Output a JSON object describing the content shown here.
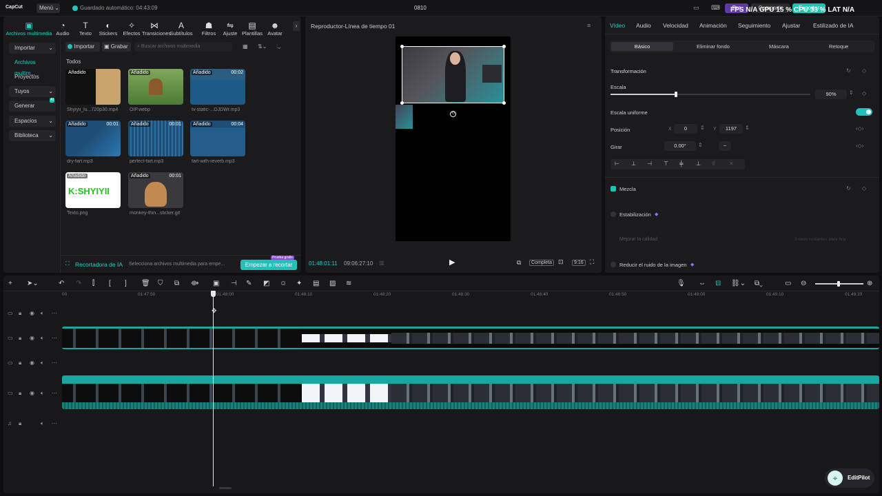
{
  "app": {
    "logo": "CapCut",
    "menu": "Menú",
    "autosave": "Guardado automático: 04:43:09",
    "project_title": "0810",
    "pro": "Pro",
    "share": "Compartir",
    "export": "Exportar",
    "perf": "FPS N/A  GPU 15 %  CPU 33 %  LAT N/A"
  },
  "toolbar": {
    "items": [
      {
        "label": "Archivos multimedia",
        "icon": "media-icon"
      },
      {
        "label": "Audio",
        "icon": "audio-icon"
      },
      {
        "label": "Texto",
        "icon": "text-icon"
      },
      {
        "label": "Stickers",
        "icon": "sticker-icon"
      },
      {
        "label": "Efectos",
        "icon": "effects-icon"
      },
      {
        "label": "Transiciones",
        "icon": "transition-icon"
      },
      {
        "label": "Subtítulos",
        "icon": "subtitle-icon"
      },
      {
        "label": "Filtros",
        "icon": "filter-icon"
      },
      {
        "label": "Ajuste",
        "icon": "adjust-icon"
      },
      {
        "label": "Plantillas",
        "icon": "template-icon"
      },
      {
        "label": "Avatar",
        "icon": "avatar-icon"
      }
    ]
  },
  "sidebar": {
    "items": [
      "Importar",
      "Archivos multim...",
      "Proyectos secun...",
      "Tuyos",
      "Generar",
      "Espacios",
      "Biblioteca"
    ],
    "generar_badge": "AI"
  },
  "media": {
    "import_btn": "Importar",
    "record_btn": "Grabar",
    "search_placeholder": "Buscar archivos multimedia",
    "section": "Todos",
    "added": "Añadido",
    "items": [
      {
        "name": "Shyiyii_lu...720p30.mp4",
        "dur": ""
      },
      {
        "name": "OIP.webp",
        "dur": ""
      },
      {
        "name": "tv-static-...OJDWr.mp3",
        "dur": "00:02"
      },
      {
        "name": "dry-fart.mp3",
        "dur": "00:01"
      },
      {
        "name": "perfect-fart.mp3",
        "dur": "00:01"
      },
      {
        "name": "fart-with-reverb.mp3",
        "dur": "00:04"
      },
      {
        "name": "Texto.png",
        "dur": ""
      },
      {
        "name": "monkey-thin...sticker.gif",
        "dur": "00:01"
      }
    ],
    "ai_cropper": "Recortadora de IA",
    "ai_hint": "Selecciona archivos multimedia para empe...",
    "ai_btn": "Empezar a recortar",
    "ai_tag": "Prueba gratis",
    "text_png_content": "K:SHYIYII"
  },
  "player": {
    "title": "Reproductor-Línea de tiempo 01",
    "current": "01:48:01:11",
    "total": "09:06:27:10",
    "quality": "Completa",
    "ratio": "9:16"
  },
  "props": {
    "tabs": [
      "Vídeo",
      "Audio",
      "Velocidad",
      "Animación",
      "Seguimiento",
      "Ajustar",
      "Estilizado de IA"
    ],
    "subtabs": [
      "Básico",
      "Eliminar fondo",
      "Máscara",
      "Retoque"
    ],
    "transform": "Transformación",
    "scale": "Escala",
    "scale_value": "90%",
    "scale_fraction": 0.9,
    "uniform": "Escala uniforme",
    "position": "Posición",
    "pos_x_label": "X",
    "pos_x": "0",
    "pos_y_label": "Y",
    "pos_y": "1197",
    "rotate": "Girar",
    "rotate_value": "0.00°",
    "blend": "Mezcla",
    "stab": "Estabilización",
    "quality_upgrade": "Mejorar la calidad",
    "quality_hint": "3 usos restantes para hoy",
    "denoise": "Reducir el ruido de la imagen"
  },
  "timeline": {
    "ruler": [
      "00",
      "01:47:50",
      "01:48:00",
      "01:48:10",
      "01:48:20",
      "01:48:30",
      "01:48:40",
      "01:48:50",
      "01:49:00",
      "01:49:10",
      "01:49:20"
    ]
  },
  "assistant": {
    "label": "EditPilot"
  }
}
